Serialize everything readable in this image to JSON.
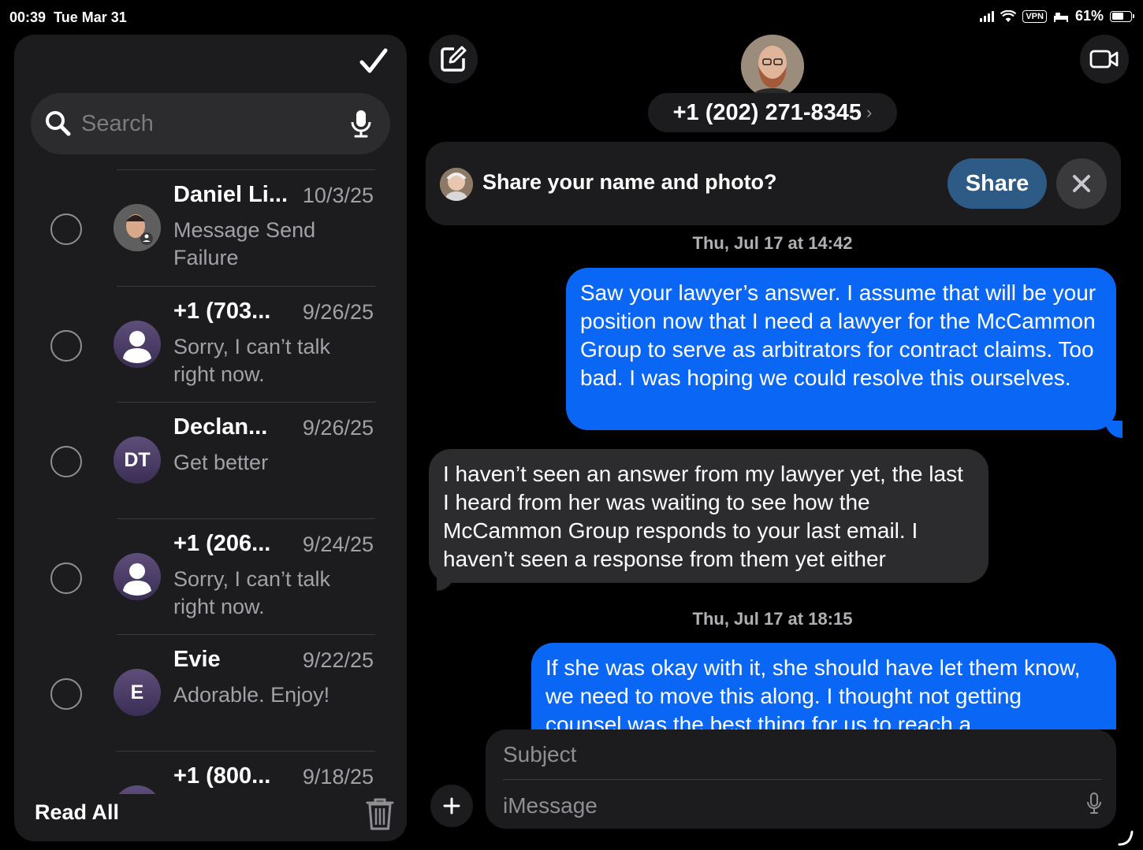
{
  "status": {
    "time": "00:39",
    "date": "Tue Mar 31",
    "vpn": "VPN",
    "battery": "61%",
    "battery_level": 0.61
  },
  "sidebar": {
    "search_placeholder": "Search",
    "conversations": [
      {
        "name": "Daniel Li...",
        "date": "10/3/25",
        "preview": "Message Send Failure",
        "avatar_type": "photo",
        "initials": ""
      },
      {
        "name": "+1 (703...",
        "date": "9/26/25",
        "preview": "Sorry, I can’t talk right now.",
        "avatar_type": "person",
        "initials": ""
      },
      {
        "name": "Declan...",
        "date": "9/26/25",
        "preview": "Get better",
        "avatar_type": "initials",
        "initials": "DT"
      },
      {
        "name": "+1 (206...",
        "date": "9/24/25",
        "preview": "Sorry, I can’t talk right now.",
        "avatar_type": "person",
        "initials": ""
      },
      {
        "name": "Evie",
        "date": "9/22/25",
        "preview": "Adorable. Enjoy!",
        "avatar_type": "initials",
        "initials": "E"
      },
      {
        "name": "+1 (800...",
        "date": "9/18/25",
        "preview": "",
        "avatar_type": "person",
        "initials": ""
      }
    ],
    "read_all_label": "Read All"
  },
  "chat": {
    "contact_number": "+1 (202) 271-8345",
    "share_banner": {
      "text": "Share your name and photo?",
      "button_label": "Share"
    },
    "timestamps": [
      "Thu, Jul 17 at 14:42",
      "Thu, Jul 17 at 18:15"
    ],
    "messages": [
      {
        "direction": "sent",
        "text": "Saw your lawyer’s answer. I assume that will be your position now that I need a lawyer for the McCammon Group to serve as arbitrators for contract claims. Too bad. I was hoping we could resolve this ourselves."
      },
      {
        "direction": "received",
        "text": "I haven’t seen an answer from my lawyer yet, the last I heard from her was waiting to see how the McCammon Group responds to your last email. I haven’t seen a response from them yet either"
      },
      {
        "direction": "sent",
        "text": "If she was okay with it, she should have let them know, we need to move this along. I thought not getting counsel was the best thing for us to reach a"
      }
    ],
    "compose": {
      "subject_placeholder": "Subject",
      "message_placeholder": "iMessage"
    }
  }
}
